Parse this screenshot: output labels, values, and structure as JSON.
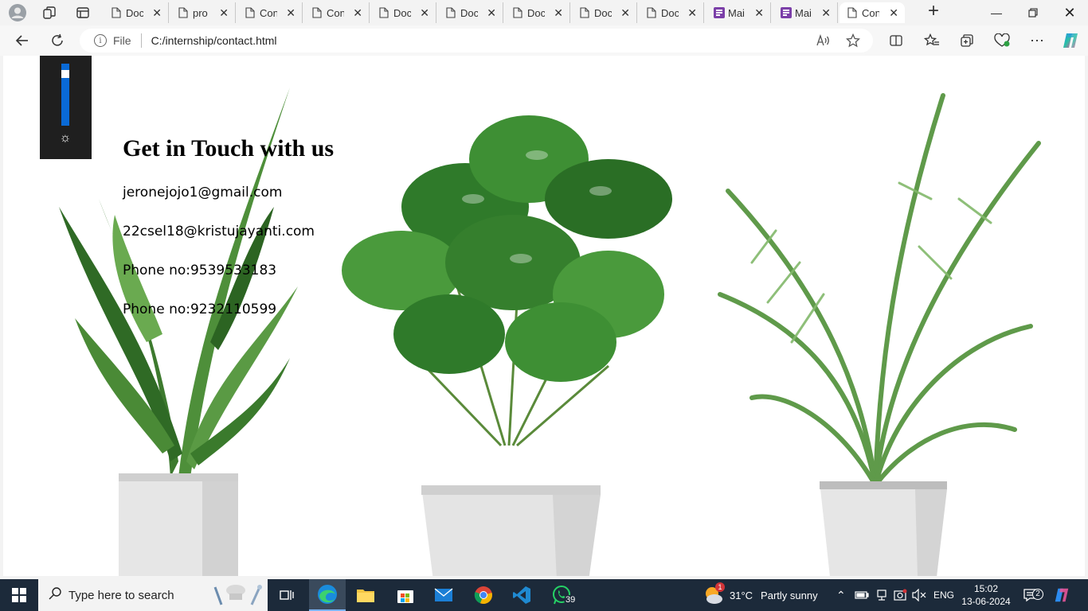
{
  "browser": {
    "tabs": [
      {
        "title": "Doc",
        "icon": "document-icon"
      },
      {
        "title": "pro",
        "icon": "document-icon"
      },
      {
        "title": "Con",
        "icon": "document-icon"
      },
      {
        "title": "Con",
        "icon": "document-icon"
      },
      {
        "title": "Doc",
        "icon": "document-icon"
      },
      {
        "title": "Doc",
        "icon": "document-icon"
      },
      {
        "title": "Doc",
        "icon": "document-icon"
      },
      {
        "title": "Doc",
        "icon": "document-icon"
      },
      {
        "title": "Doc",
        "icon": "document-icon"
      },
      {
        "title": "Mai",
        "icon": "forms-icon"
      },
      {
        "title": "Mai",
        "icon": "forms-icon"
      },
      {
        "title": "Con",
        "icon": "document-icon",
        "active": true
      }
    ],
    "address": {
      "scheme_label": "File",
      "url": "C:/internship/contact.html"
    }
  },
  "page": {
    "heading": "Get in Touch with us",
    "lines": [
      "jeronejojo1@gmail.com",
      "22csel18@kristujayanti.com",
      "Phone no:9539533183",
      "Phone no:9232110599"
    ],
    "brightness_level": 0.88
  },
  "taskbar": {
    "search_placeholder": "Type here to search",
    "whatsapp_badge": "39",
    "weather": {
      "temp": "31°C",
      "condition": "Partly sunny",
      "alert_count": "1"
    },
    "language": "ENG",
    "time": "15:02",
    "date": "13-06-2024",
    "notification_count": "2"
  },
  "colors": {
    "accent": "#0a6ad6",
    "taskbar_bg": "#1c2a3a"
  }
}
